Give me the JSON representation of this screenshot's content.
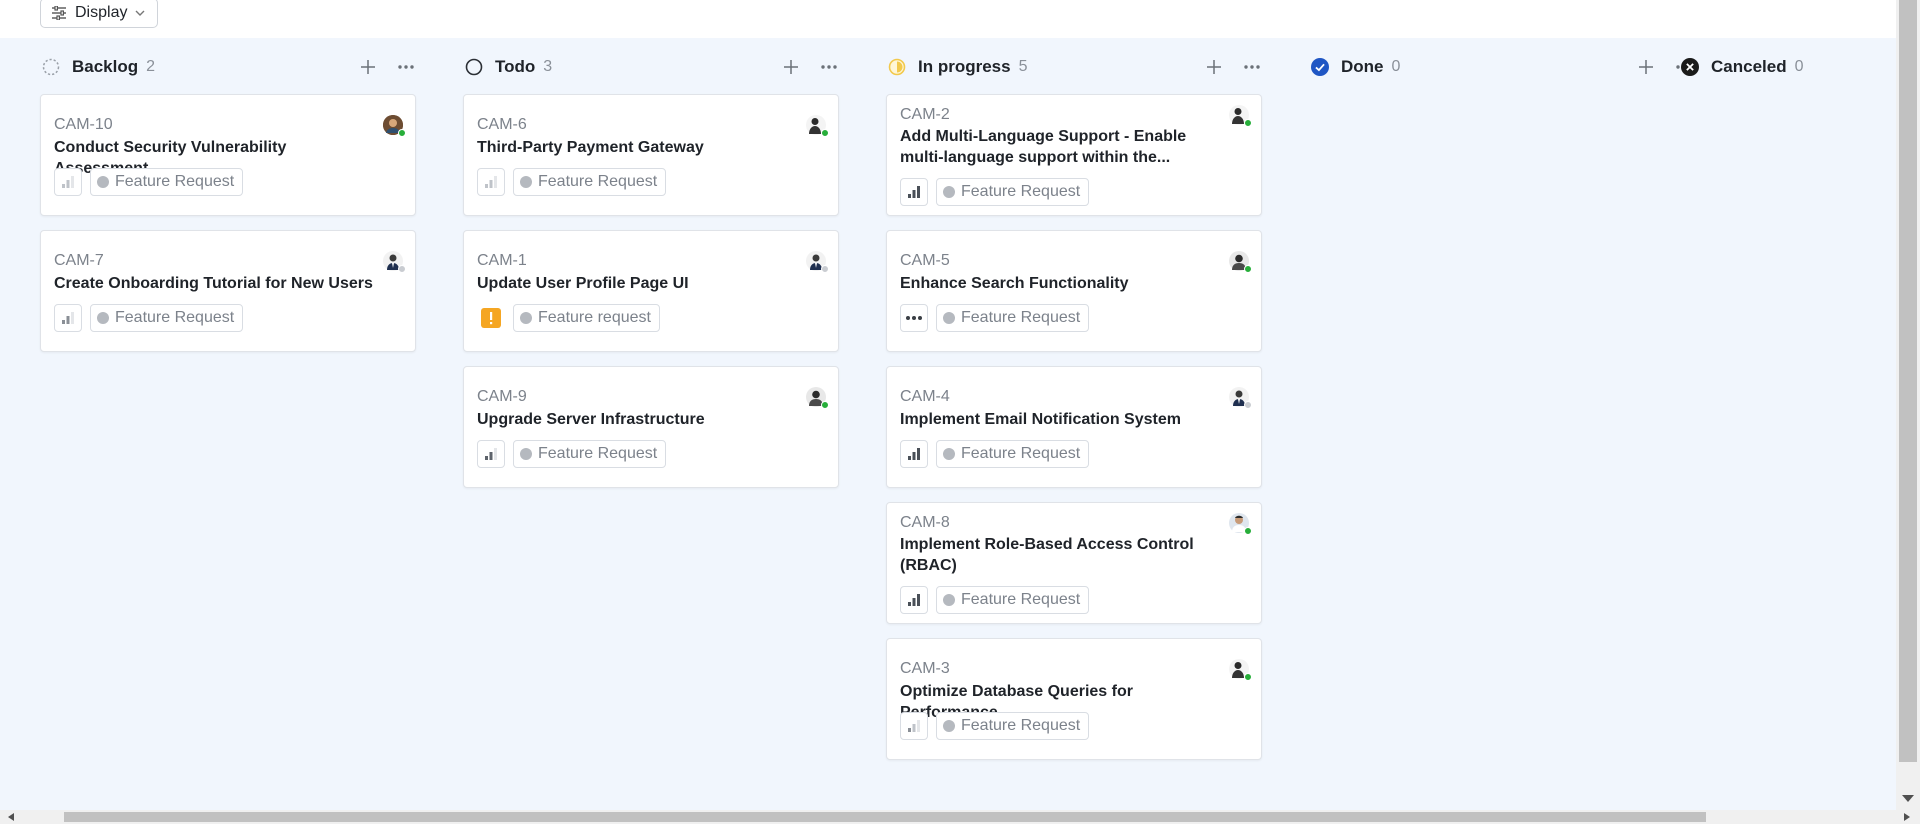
{
  "toolbar": {
    "display_label": "Display"
  },
  "columns": [
    {
      "title": "Backlog",
      "count": "2",
      "status_icon": "backlog-dashed-circle-icon",
      "cards": [
        {
          "id": "CAM-10",
          "title": "Conduct Security Vulnerability Assessment",
          "label": "Feature Request",
          "priority": "low",
          "avatar_status": "online"
        },
        {
          "id": "CAM-7",
          "title": "Create Onboarding Tutorial for New Users",
          "label": "Feature Request",
          "priority": "medium",
          "avatar_status": "away"
        }
      ]
    },
    {
      "title": "Todo",
      "count": "3",
      "status_icon": "todo-circle-icon",
      "cards": [
        {
          "id": "CAM-6",
          "title": "Third-Party Payment Gateway",
          "label": "Feature Request",
          "priority": "low",
          "avatar_status": "online"
        },
        {
          "id": "CAM-1",
          "title": "Update User Profile Page UI",
          "label": "Feature request",
          "priority": "urgent",
          "avatar_status": "away"
        },
        {
          "id": "CAM-9",
          "title": "Upgrade Server Infrastructure",
          "label": "Feature Request",
          "priority": "medium",
          "avatar_status": "online"
        }
      ]
    },
    {
      "title": "In progress",
      "count": "5",
      "status_icon": "in-progress-half-circle-icon",
      "cards": [
        {
          "id": "CAM-2",
          "title": "Add Multi-Language Support - Enable multi-language support within the...",
          "label": "Feature Request",
          "priority": "high",
          "avatar_status": "online"
        },
        {
          "id": "CAM-5",
          "title": "Enhance Search Functionality",
          "label": "Feature Request",
          "priority": "none",
          "avatar_status": "online"
        },
        {
          "id": "CAM-4",
          "title": "Implement Email Notification System",
          "label": "Feature Request",
          "priority": "high",
          "avatar_status": "away"
        },
        {
          "id": "CAM-8",
          "title": "Implement Role-Based Access Control (RBAC)",
          "label": "Feature Request",
          "priority": "high",
          "avatar_status": "online"
        },
        {
          "id": "CAM-3",
          "title": "Optimize Database Queries for Performance",
          "label": "Feature Request",
          "priority": "low",
          "avatar_status": "online"
        }
      ]
    },
    {
      "title": "Done",
      "count": "0",
      "status_icon": "done-check-circle-icon",
      "cards": []
    },
    {
      "title": "Canceled",
      "count": "0",
      "status_icon": "canceled-x-circle-icon",
      "cards": []
    }
  ],
  "colors": {
    "accent": "#1f56c4",
    "in_progress": "#f2c94c",
    "online": "#27ae3a",
    "away": "#c9ccd1",
    "urgent": "#f5a623"
  }
}
